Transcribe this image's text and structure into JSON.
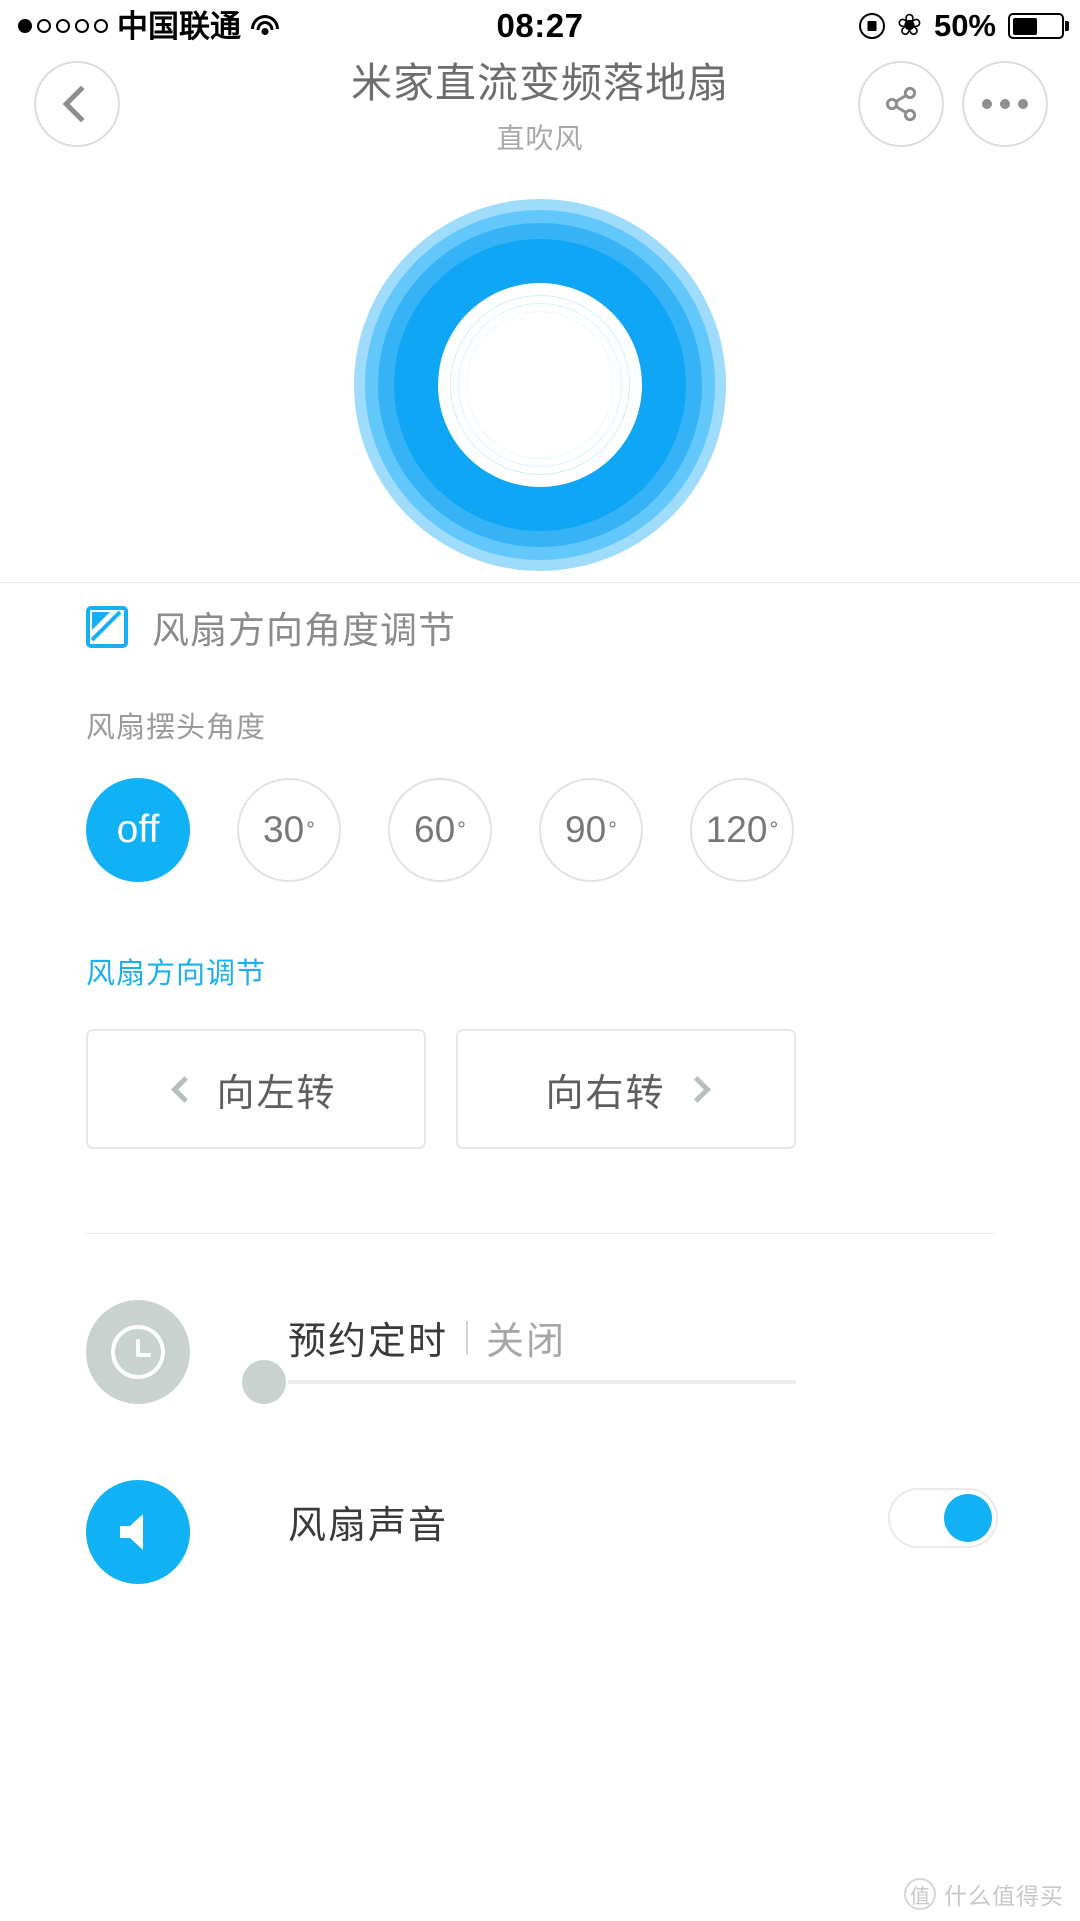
{
  "status_bar": {
    "carrier": "中国联通",
    "signal_dots_total": 5,
    "signal_dots_filled": 1,
    "wifi_icon": "wifi-icon",
    "time": "08:27",
    "rotation_lock_icon": "rotation-lock-icon",
    "bluetooth_icon": "bluetooth-icon",
    "battery_percent": "50%",
    "battery_level": 50
  },
  "navbar": {
    "back_icon": "chevron-left-icon",
    "title": "米家直流变频落地扇",
    "subtitle": "直吹风",
    "share_icon": "share-icon",
    "more_icon": "more-dots-icon"
  },
  "hero": {
    "fan_ring_icon": "fan-ring-indicator",
    "ring_colors": [
      "#9fdcfb",
      "#62c7fa",
      "#36b2f7",
      "#0fa6f5"
    ],
    "accent": "#10b1f5"
  },
  "direction_section": {
    "icon": "angle-adjust-icon",
    "header": "风扇方向角度调节",
    "swing_label": "风扇摆头角度",
    "angles": [
      {
        "label": "off",
        "degree": "",
        "selected": true
      },
      {
        "label": "30",
        "degree": "°",
        "selected": false
      },
      {
        "label": "60",
        "degree": "°",
        "selected": false
      },
      {
        "label": "90",
        "degree": "°",
        "selected": false
      },
      {
        "label": "120",
        "degree": "°",
        "selected": false
      }
    ],
    "direction_label": "风扇方向调节",
    "turn_left": "向左转",
    "turn_right": "向右转",
    "turn_left_icon": "chevron-left-icon",
    "turn_right_icon": "chevron-right-icon"
  },
  "timer_row": {
    "icon": "clock-icon",
    "name": "预约定时",
    "value": "关闭",
    "slider_position_percent": 0
  },
  "sound_row": {
    "icon": "speaker-icon",
    "name": "风扇声音",
    "toggle_state": "on"
  },
  "watermark": {
    "badge": "值",
    "text": "什么值得买"
  }
}
